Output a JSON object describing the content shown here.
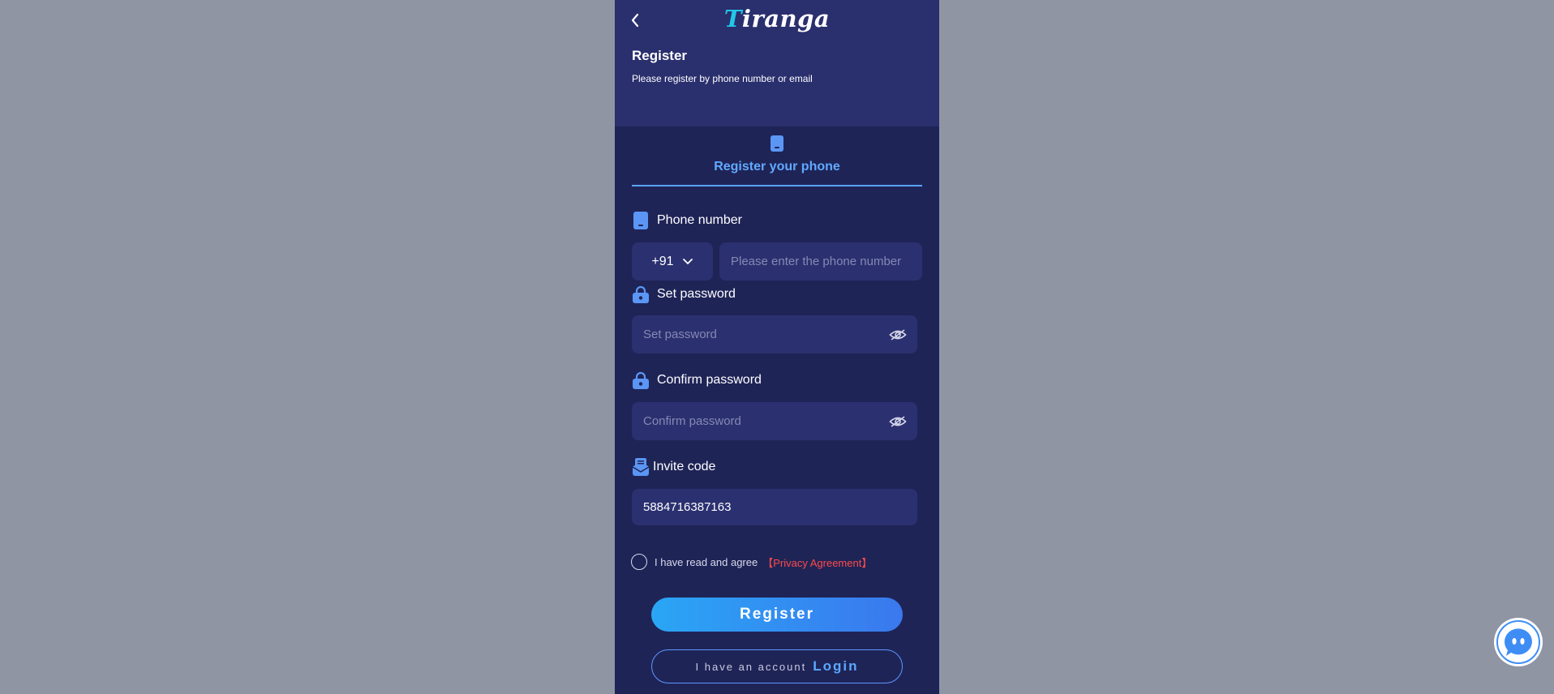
{
  "header": {
    "logo_t": "T",
    "logo_rest": "iranga",
    "title": "Register",
    "subtitle": "Please register by phone number or email"
  },
  "tab": {
    "label": "Register your phone"
  },
  "phone": {
    "label": "Phone number",
    "country_code": "+91",
    "placeholder": "Please enter the phone number"
  },
  "password": {
    "label": "Set password",
    "placeholder": "Set password"
  },
  "confirm_password": {
    "label": "Confirm password",
    "placeholder": "Confirm password"
  },
  "invite": {
    "label": "Invite code",
    "value": "5884716387163"
  },
  "agreement": {
    "text": "I have read and agree",
    "link": "【Privacy Agreement】"
  },
  "buttons": {
    "register": "Register",
    "have_account": "I have an account",
    "login": "Login"
  },
  "colors": {
    "accent": "#61a9ff",
    "background": "#1f2457",
    "header": "#2a2f6e",
    "link_red": "#ff4a4a"
  },
  "icons": [
    "back-icon",
    "phone-icon",
    "lock-icon",
    "eye-off-icon",
    "invite-icon",
    "chat-bot-icon"
  ]
}
